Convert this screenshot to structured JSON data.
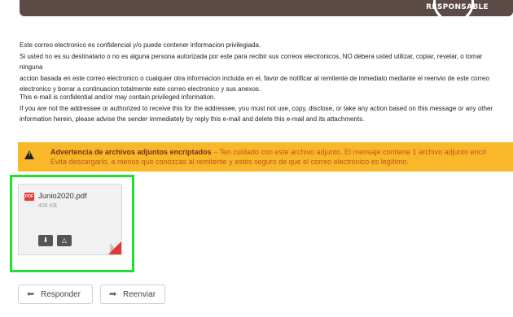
{
  "header": {
    "logo_text": "RESPONSABLE"
  },
  "disclaimer_es": {
    "line1": "Este correo electronico es confidencial y/o puede contener informacion privilegiada.",
    "line2": "Si usted no es su destinatario o no es alguna persona autorizada por este para recibir sus correos electronicos, NO debera usted utilizar, copiar, revelar, o tomar ninguna",
    "line3": "accion basada en este correo electronico o cualquier otra informacion incluida en el, favor de notificar al remitente de inmediato mediante el reenvio de este correo",
    "line4": "electronico y borrar a continuacion totalmente este correo electronico y sus anexos."
  },
  "disclaimer_en": {
    "line1": "This e-mail is confidential and/or may contain privileged information.",
    "line2": "If you are not the addressee or authorized to receive this for the addressee, you must not use, copy, disclose, or take any action based on this message or any other",
    "line3": "information herein, please advise the sender immediately by reply this e-mail and delete this e-mail and its attachments."
  },
  "warning": {
    "title": "Advertencia de archivos adjuntos encriptados",
    "dash": " – ",
    "body_line1": "Ten cuidado con este archivo adjunto. El mensaje contiene 1 archivo adjunto encri",
    "body_line2": "Evita descargarlo, a menos que conozcas al remitente y estés seguro de que el correo electrónico es legítimo.",
    "colors": {
      "background": "#f9b82a",
      "title": "#7a2f18",
      "body": "#c0541c"
    }
  },
  "attachment": {
    "name": "Junio2020.pdf",
    "size": "405 KB",
    "badge": "PDF",
    "download_icon": "download-icon",
    "drive_icon": "save-to-drive-icon",
    "highlight_color": "#22dd33"
  },
  "actions": {
    "reply_label": "Responder",
    "forward_label": "Reenviar",
    "reply_icon": "reply-arrow-icon",
    "forward_icon": "forward-arrow-icon"
  }
}
